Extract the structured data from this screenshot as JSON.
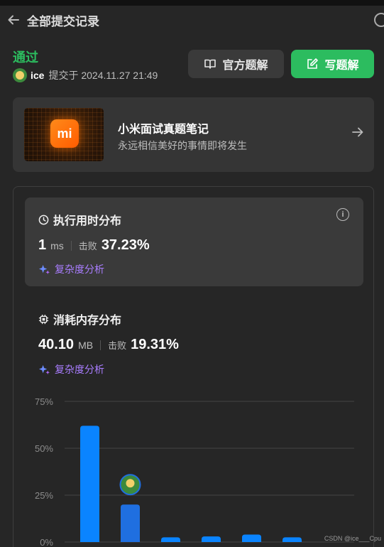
{
  "header": {
    "title": "全部提交记录",
    "back_icon": "arrow-left-icon"
  },
  "submission": {
    "status": "通过",
    "user": "ice",
    "submitted_text": "提交于 2024.11.27 21:49"
  },
  "buttons": {
    "official": "官方题解",
    "write": "写题解"
  },
  "banner": {
    "logo_text": "mi",
    "title": "小米面试真题笔记",
    "subtitle": "永远相信美好的事情即将发生"
  },
  "runtime": {
    "title": "执行用时分布",
    "value": "1",
    "unit": "ms",
    "beat_label": "击败",
    "beat_pct": "37.23%",
    "complexity": "复杂度分析"
  },
  "memory": {
    "title": "消耗内存分布",
    "value": "40.10",
    "unit": "MB",
    "beat_label": "击败",
    "beat_pct": "19.31%",
    "complexity": "复杂度分析"
  },
  "chart_data": {
    "type": "bar",
    "ylim": [
      0,
      75
    ],
    "yticks": [
      "75%",
      "50%",
      "25%",
      "0%"
    ],
    "values": [
      62,
      20,
      2.5,
      3,
      4,
      2.5
    ],
    "highlight_index": 1,
    "colors": {
      "bar": "#0a84ff",
      "highlight": "#1f6fe0",
      "grid": "#444444"
    }
  },
  "watermark": "CSDN @ice___Cpu"
}
